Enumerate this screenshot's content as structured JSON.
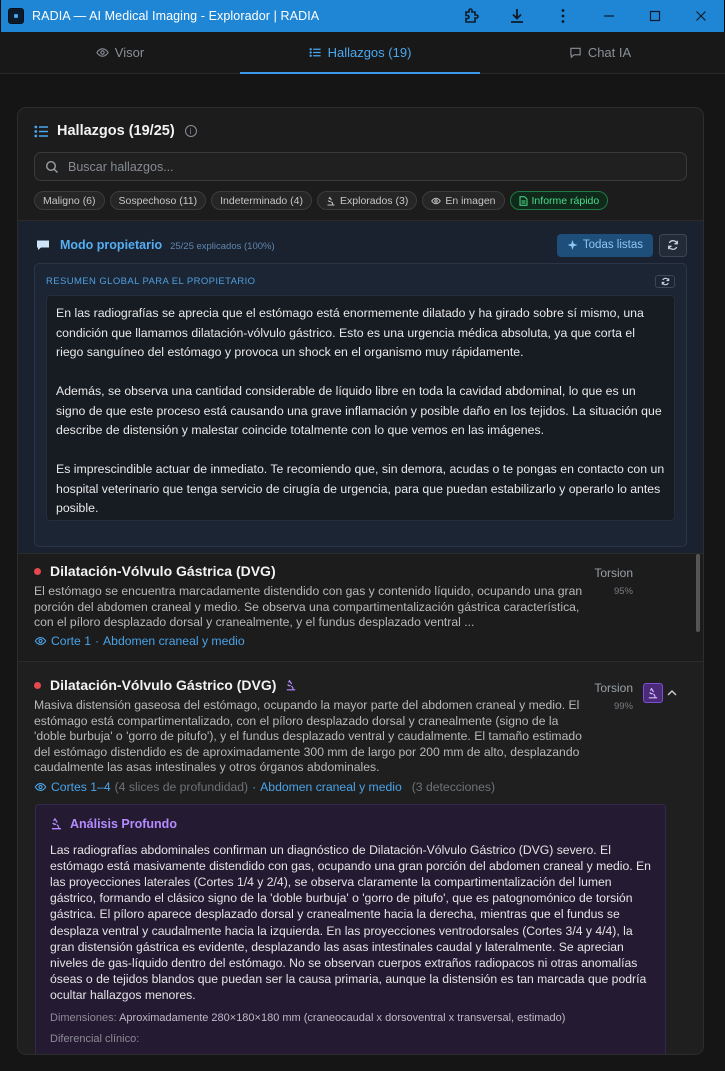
{
  "window": {
    "title": "RADIA — AI Medical Imaging - Explorador | RADIA"
  },
  "tabs": [
    {
      "label": "Visor",
      "icon": "eye-icon"
    },
    {
      "label": "Hallazgos (19)",
      "icon": "list-icon",
      "active": true
    },
    {
      "label": "Chat IA",
      "icon": "chat-icon"
    }
  ],
  "panel": {
    "title": "Hallazgos (19/25)",
    "search_placeholder": "Buscar hallazgos...",
    "filters": [
      {
        "label": "Maligno (6)"
      },
      {
        "label": "Sospechoso (11)"
      },
      {
        "label": "Indeterminado (4)"
      },
      {
        "label": "Explorados (3)",
        "icon": "microscope-icon"
      },
      {
        "label": "En imagen",
        "icon": "eye-icon"
      },
      {
        "label": "Informe rápido",
        "icon": "document-icon"
      }
    ]
  },
  "owner_mode": {
    "title": "Modo propietario",
    "subtitle": "25/25 explicados (100%)",
    "all_ready_label": "Todas listas",
    "summary_label": "RESUMEN GLOBAL PARA EL PROPIETARIO",
    "summary_text": "En las radiografías se aprecia que el estómago está enormemente dilatado y ha girado sobre sí mismo, una condición que llamamos dilatación-vólvulo gástrico. Esto es una urgencia médica absoluta, ya que corta el riego sanguíneo del estómago y provoca un shock en el organismo muy rápidamente.\n\nAdemás, se observa una cantidad considerable de líquido libre en toda la cavidad abdominal, lo que es un signo de que este proceso está causando una grave inflamación y posible daño en los tejidos. La situación que describe de distensión y malestar coincide totalmente con lo que vemos en las imágenes.\n\nEs imprescindible actuar de inmediato. Te recomiendo que, sin demora, acudas o te pongas en contacto con un hospital veterinario que tenga servicio de cirugía de urgencia, para que puedan estabilizarlo y operarlo lo antes posible."
  },
  "findings": [
    {
      "title": "Dilatación-Vólvulo Gástrica (DVG)",
      "status_color": "#e5484d",
      "description": "El estómago se encuentra marcadamente distendido con gas y contenido líquido, ocupando una gran porción del abdomen craneal y medio. Se observa una compartimentalización gástrica característica, con el píloro desplazado dorsal y cranealmente, y el fundus desplazado ventral ...",
      "slice": "Corte 1",
      "separator": "·",
      "region": "Abdomen craneal y medio",
      "tag": "Torsion",
      "confidence": "95%"
    },
    {
      "title": "Dilatación-Vólvulo Gástrico (DVG)",
      "status_color": "#e5484d",
      "description": "Masiva distensión gaseosa del estómago, ocupando la mayor parte del abdomen craneal y medio. El estómago está compartimentalizado, con el píloro desplazado dorsal y cranealmente (signo de la 'doble burbuja' o 'gorro de pitufo'), y el fundus desplazado ventral y caudalmente. El tamaño estimado del estómago distendido es de aproximadamente 300 mm de largo por 200 mm de alto, desplazando caudalmente las asas intestinales y otros órganos abdominales.",
      "slices": "Cortes 1–4",
      "slices_note": "(4 slices de profundidad)",
      "separator": "·",
      "region": "Abdomen craneal y medio",
      "detections": "(3 detecciones)",
      "tag": "Torsion",
      "confidence": "99%",
      "deep": {
        "title": "Análisis Profundo",
        "text": "Las radiografías abdominales confirman un diagnóstico de Dilatación-Vólvulo Gástrico (DVG) severo. El estómago está masivamente distendido con gas, ocupando una gran porción del abdomen craneal y medio. En las proyecciones laterales (Cortes 1/4 y 2/4), se observa claramente la compartimentalización del lumen gástrico, formando el clásico signo de la 'doble burbuja' o 'gorro de pitufo', que es patognomónico de torsión gástrica. El píloro aparece desplazado dorsal y cranealmente hacia la derecha, mientras que el fundus se desplaza ventral y caudalmente hacia la izquierda. En las proyecciones ventrodorsales (Cortes 3/4 y 4/4), la gran distensión gástrica es evidente, desplazando las asas intestinales caudal y lateralmente. Se aprecian niveles de gas-líquido dentro del estómago. No se observan cuerpos extraños radiopacos ni otras anomalías óseas o de tejidos blandos que puedan ser la causa primaria, aunque la distensión es tan marcada que podría ocultar hallazgos menores.",
        "dimensions_label": "Dimensiones:",
        "dimensions_value": "Aproximadamente 280×180×180 mm (craneocaudal x dorsoventral x transversal, estimado)",
        "differential_label": "Diferencial clínico:"
      }
    }
  ]
}
